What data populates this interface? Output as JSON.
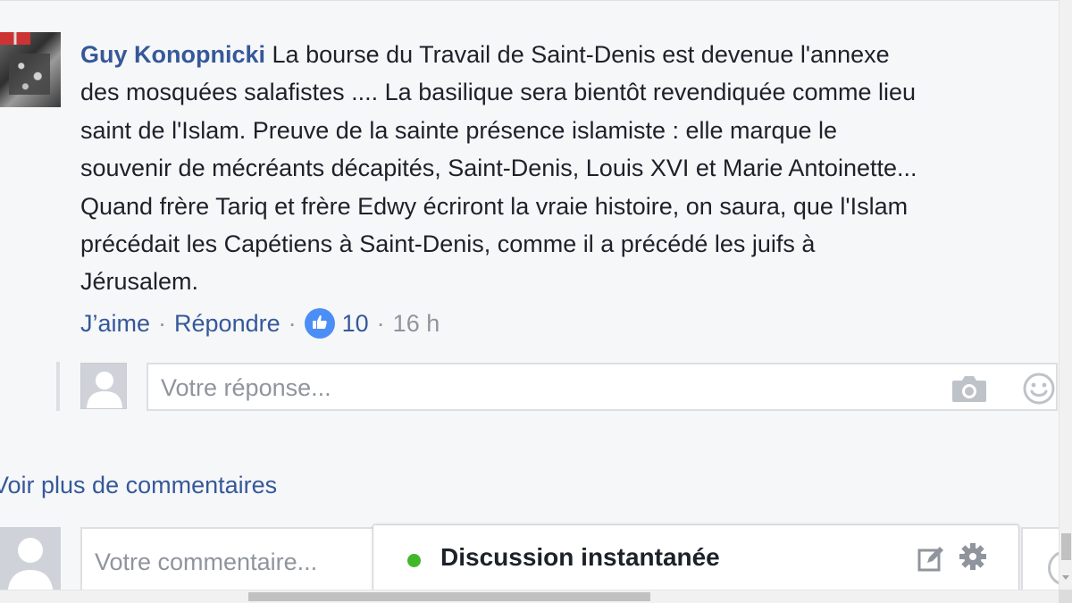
{
  "comment": {
    "author": "Guy Konopnicki",
    "lines": [
      "La bourse du Travail de Saint-Denis est devenue l'annexe",
      "des mosquées salafistes .... La basilique sera bientôt revendiquée comme lieu",
      "saint de l'Islam. Preuve de la sainte présence islamiste : elle marque le",
      "souvenir de mécréants décapités, Saint-Denis, Louis XVI et Marie Antoinette...",
      "Quand frère Tariq et frère Edwy écriront la vraie histoire, on saura, que l'Islam",
      "précédait les Capétiens à Saint-Denis, comme il a précédé les juifs à",
      "Jérusalem."
    ],
    "actions": {
      "like_label": "J’aime",
      "reply_label": "Répondre",
      "separator": "·",
      "reaction_count": "10",
      "time": "16 h"
    }
  },
  "reply": {
    "placeholder": "Votre réponse..."
  },
  "more_comments_label": "Voir plus de commentaires",
  "comment_box": {
    "placeholder": "Votre commentaire..."
  },
  "chat": {
    "title": "Discussion instantanée",
    "status_color": "#42b72a"
  },
  "colors": {
    "link": "#365899",
    "text": "#1d2129",
    "muted": "#90949c",
    "like_badge": "#4b8ef5"
  },
  "icons": [
    "like-icon",
    "camera-icon",
    "smiley-icon",
    "compose-icon",
    "gear-icon",
    "avatar-placeholder-icon"
  ]
}
